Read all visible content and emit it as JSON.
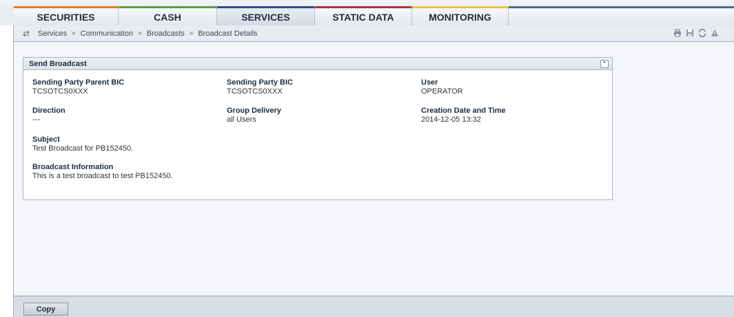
{
  "nav": {
    "tabs": [
      {
        "label": "SECURITIES",
        "color": "#e07b2a"
      },
      {
        "label": "CASH",
        "color": "#5a9e4b"
      },
      {
        "label": "SERVICES",
        "color": "#2e4f86"
      },
      {
        "label": "STATIC DATA",
        "color": "#a3383e"
      },
      {
        "label": "MONITORING",
        "color": "#e8c443"
      }
    ],
    "active_tab": "SERVICES"
  },
  "breadcrumb": {
    "back_icon": "back-arrow-icon",
    "items": [
      "Services",
      "Communication",
      "Broadcasts",
      "Broadcast Details"
    ],
    "separator": "»",
    "tools": [
      "print-icon",
      "save-icon",
      "refresh-icon",
      "warning-icon"
    ]
  },
  "panel": {
    "title": "Send Broadcast",
    "collapse_icon": "collapse-up-icon",
    "fields": {
      "sending_party_parent_bic": {
        "label": "Sending Party Parent BIC",
        "value": "TCSOTCS0XXX"
      },
      "sending_party_bic": {
        "label": "Sending Party BIC",
        "value": "TCSOTCS0XXX"
      },
      "user": {
        "label": "User",
        "value": "OPERATOR"
      },
      "direction": {
        "label": "Direction",
        "value": "---"
      },
      "group_delivery": {
        "label": "Group Delivery",
        "value": "all Users"
      },
      "creation_date_time": {
        "label": "Creation Date and Time",
        "value": "2014-12-05 13:32"
      },
      "subject": {
        "label": "Subject",
        "value": "Test Broadcast for PB152450."
      },
      "broadcast_information": {
        "label": "Broadcast Information",
        "value": "This is a test broadcast to test PB152450."
      }
    }
  },
  "footer": {
    "copy_label": "Copy"
  }
}
